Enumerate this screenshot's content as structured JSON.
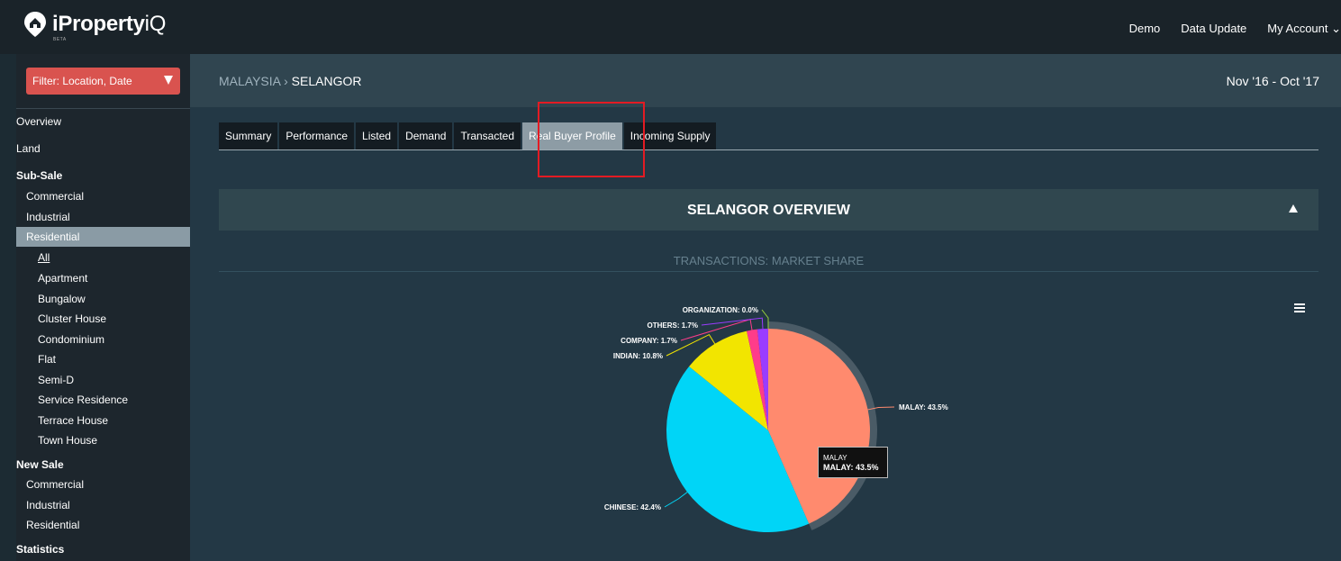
{
  "header": {
    "logo_main": "iProperty",
    "logo_suffix": "iQ",
    "logo_beta": "BETA",
    "nav": [
      "Demo",
      "Data Update",
      "My Account ⌄"
    ]
  },
  "sidebar": {
    "filter_label": "Filter: Location, Date",
    "items": [
      {
        "label": "Overview"
      },
      {
        "label": "Land"
      },
      {
        "label": "Sub-Sale"
      },
      {
        "label": "Commercial"
      },
      {
        "label": "Industrial"
      },
      {
        "label": "Residential"
      },
      {
        "label": "All"
      },
      {
        "label": "Apartment"
      },
      {
        "label": "Bungalow"
      },
      {
        "label": "Cluster House"
      },
      {
        "label": "Condominium"
      },
      {
        "label": "Flat"
      },
      {
        "label": "Semi-D"
      },
      {
        "label": "Service Residence"
      },
      {
        "label": "Terrace House"
      },
      {
        "label": "Town House"
      },
      {
        "label": "New Sale"
      },
      {
        "label": "Commercial"
      },
      {
        "label": "Industrial"
      },
      {
        "label": "Residential"
      },
      {
        "label": "Statistics"
      }
    ]
  },
  "main": {
    "breadcrumb_country": "MALAYSIA",
    "breadcrumb_sep": " › ",
    "breadcrumb_state": "SELANGOR",
    "date_range": "Nov '16 - Oct '17",
    "tabs": [
      {
        "label": "Summary"
      },
      {
        "label": "Performance"
      },
      {
        "label": "Listed"
      },
      {
        "label": "Demand"
      },
      {
        "label": "Transacted"
      },
      {
        "label": "Real Buyer Profile"
      },
      {
        "label": "Incoming Supply"
      }
    ],
    "section_title": "SELANGOR OVERVIEW",
    "chart_heading": "TRANSACTIONS: MARKET SHARE"
  },
  "tooltip": {
    "name": "MALAY",
    "value_label": "MALAY: 43.5%"
  },
  "chart_data": {
    "type": "pie",
    "title": "TRANSACTIONS: MARKET SHARE",
    "slices": [
      {
        "name": "MALAY",
        "value": 43.5,
        "color": "#ff8a6e",
        "label": "MALAY: 43.5%"
      },
      {
        "name": "CHINESE",
        "value": 42.4,
        "color": "#00d5f7",
        "label": "CHINESE: 42.4%"
      },
      {
        "name": "INDIAN",
        "value": 10.8,
        "color": "#f2e500",
        "label": "INDIAN: 10.8%"
      },
      {
        "name": "COMPANY",
        "value": 1.7,
        "color": "#ff3c8a",
        "label": "COMPANY: 1.7%"
      },
      {
        "name": "OTHERS",
        "value": 1.7,
        "color": "#9a3cff",
        "label": "OTHERS: 1.7%"
      },
      {
        "name": "ORGANIZATION",
        "value": 0.0,
        "color": "#9ad13b",
        "label": "ORGANIZATION: 0.0%"
      }
    ],
    "hovered": "MALAY"
  },
  "colors": {
    "filter_button": "#d9534f",
    "highlight_box": "#e31b23",
    "active_tab": "#8d9ca5"
  }
}
